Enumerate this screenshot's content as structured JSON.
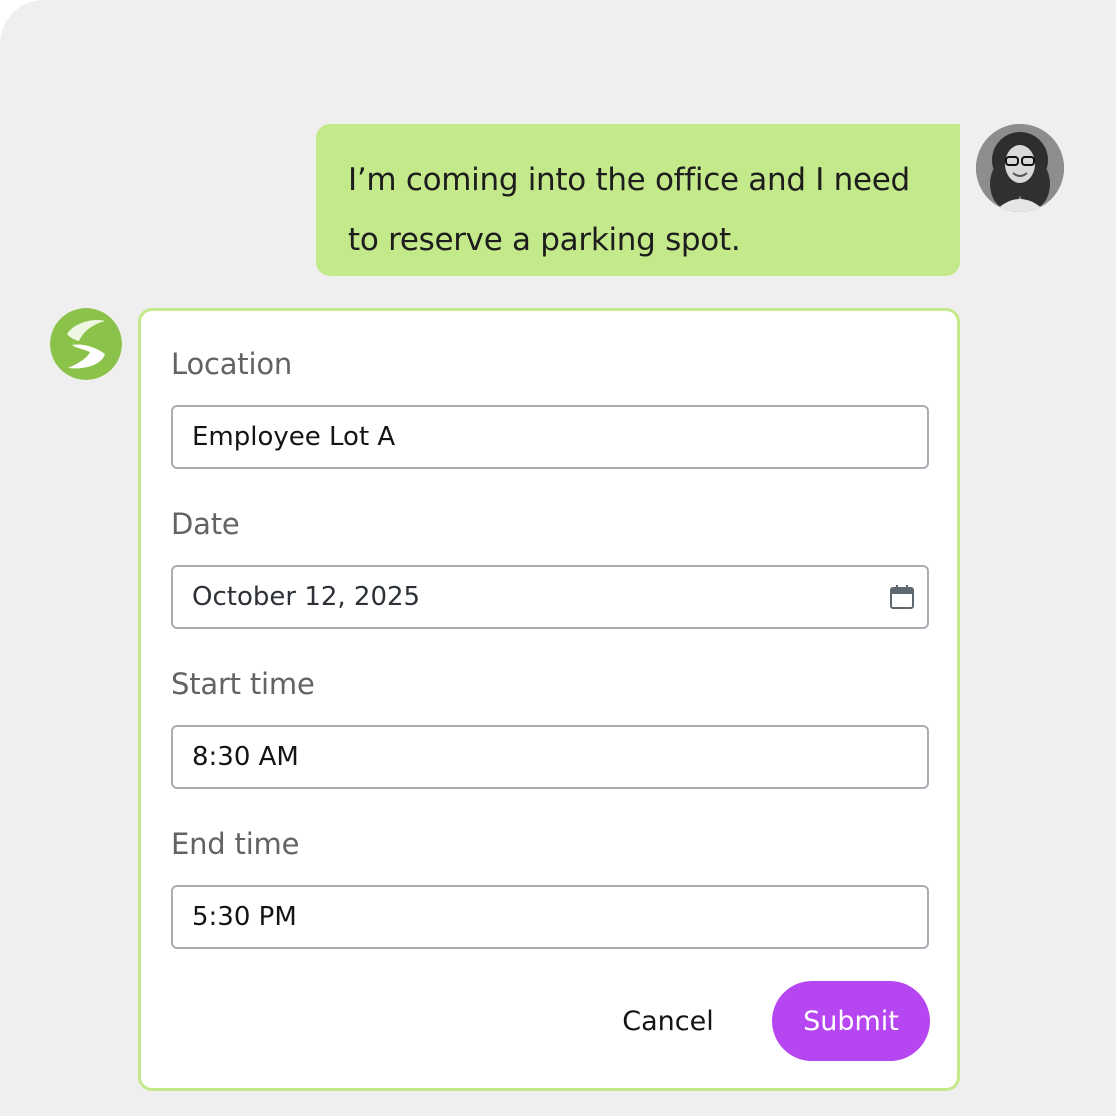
{
  "colors": {
    "background": "#efefef",
    "user_bubble": "#c4e98b",
    "card_border": "#c4e98b",
    "submit_button": "#b645f2",
    "bot_logo": "#8bc34a"
  },
  "icons": {
    "user_avatar": "user-avatar-photo",
    "bot": "leaf-logo-icon",
    "date_picker": "calendar-icon"
  },
  "user_message": {
    "line1": "I’m coming into the office and I need",
    "line2": "to reserve a parking spot."
  },
  "form": {
    "location": {
      "label": "Location",
      "value": "Employee Lot A"
    },
    "date": {
      "label": "Date",
      "value": "October 12, 2025"
    },
    "start_time": {
      "label": "Start time",
      "value": "8:30 AM"
    },
    "end_time": {
      "label": "End time",
      "value": "5:30 PM"
    },
    "cancel_label": "Cancel",
    "submit_label": "Submit"
  }
}
